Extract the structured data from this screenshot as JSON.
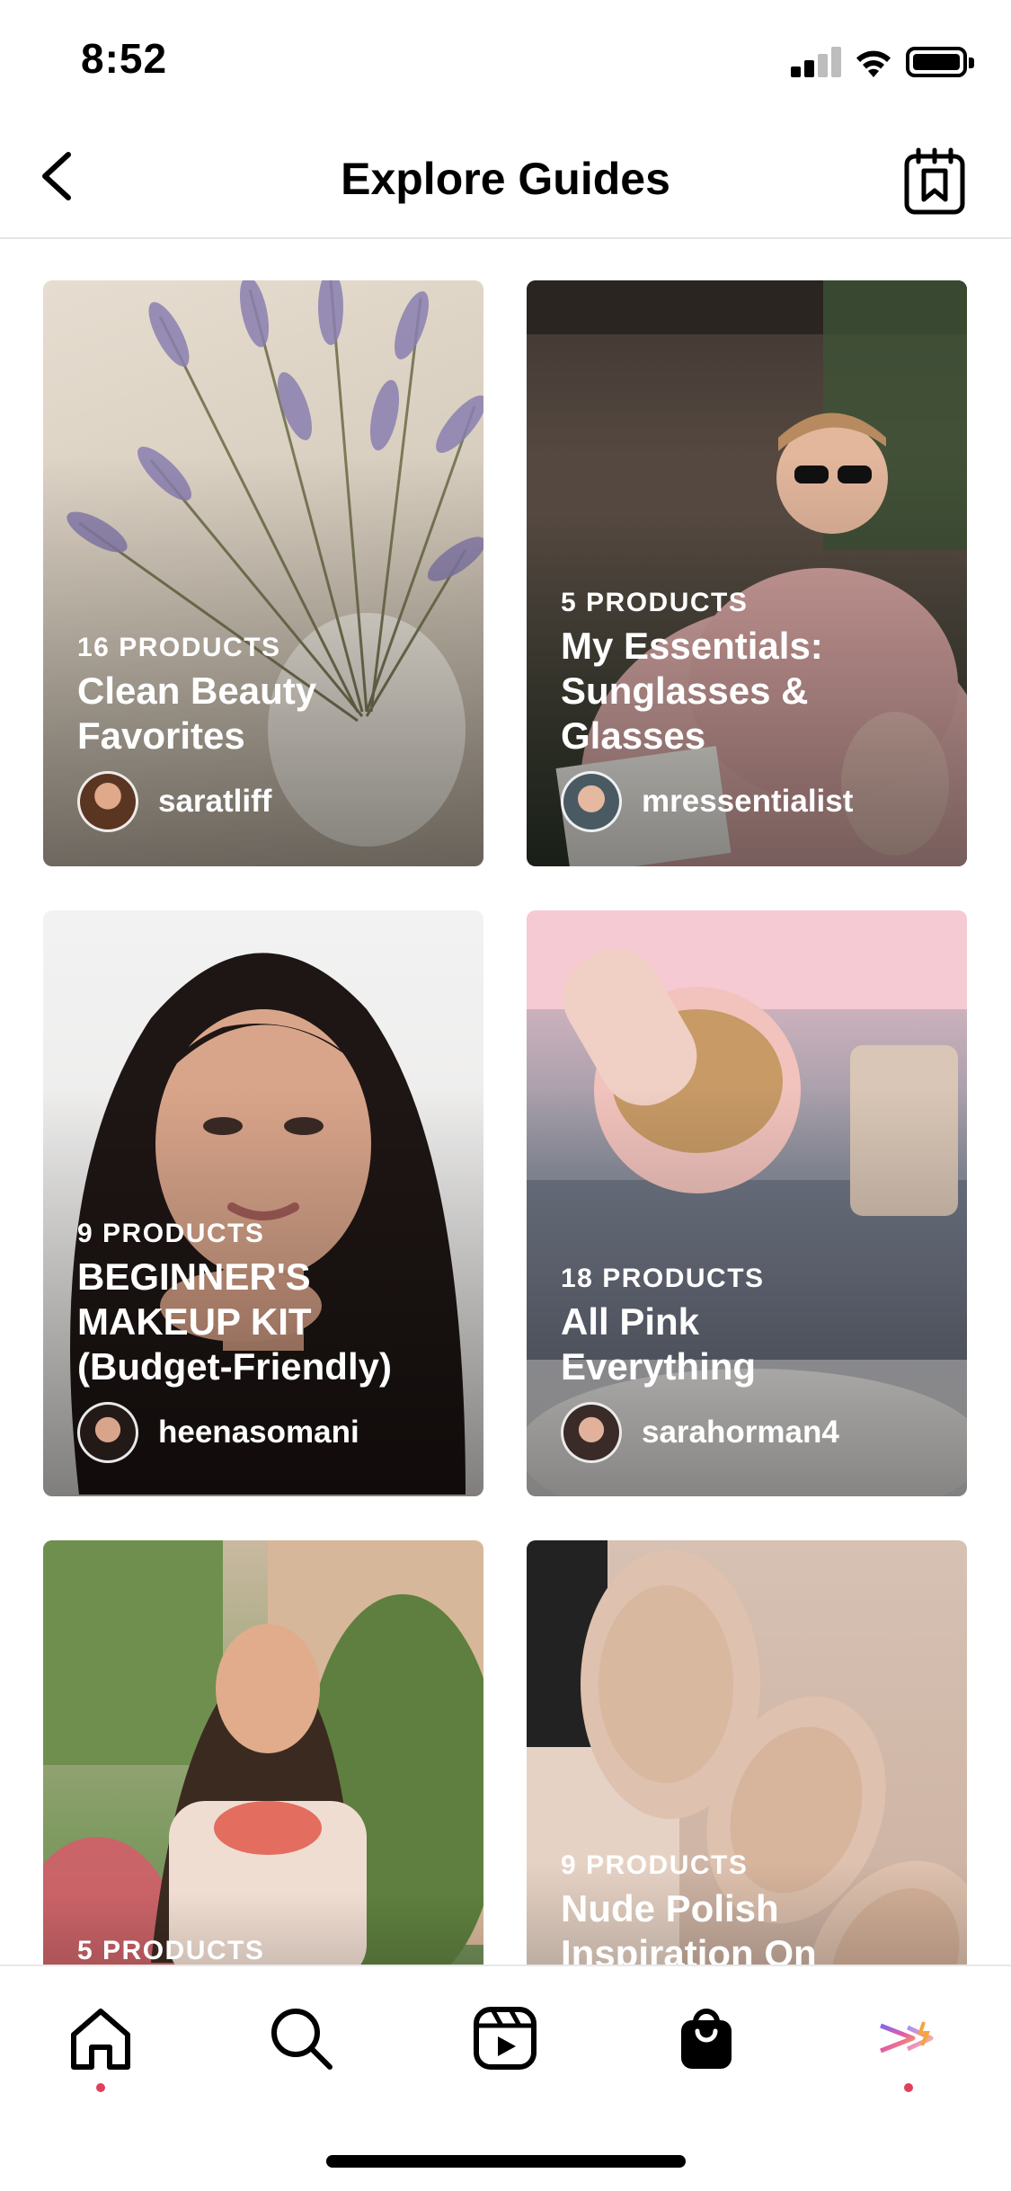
{
  "status_bar": {
    "time": "8:52"
  },
  "header": {
    "title": "Explore Guides",
    "back_icon": "chevron-left-icon",
    "bookmark_icon": "saved-guides-icon"
  },
  "guides": [
    {
      "count": "16 PRODUCTS",
      "title_lines": [
        "Clean Beauty",
        "Favorites"
      ],
      "author": "saratliff"
    },
    {
      "count": "5 PRODUCTS",
      "title_lines": [
        "My Essentials:",
        "Sunglasses &",
        "Glasses"
      ],
      "author": "mressentialist"
    },
    {
      "count": "9 PRODUCTS",
      "title_lines": [
        "BEGINNER'S",
        "MAKEUP KIT",
        "(Budget-Friendly)"
      ],
      "author": "heenasomani"
    },
    {
      "count": "18 PRODUCTS",
      "title_lines": [
        "All Pink",
        "Everything"
      ],
      "author": "sarahorman4"
    },
    {
      "count": "5 PRODUCTS",
      "title_lines": [],
      "author": ""
    },
    {
      "count": "9 PRODUCTS",
      "title_lines": [
        "Nude Polish",
        "Inspiration On"
      ],
      "author": ""
    }
  ],
  "tab_bar": {
    "items": [
      "home-icon",
      "search-icon",
      "reels-icon",
      "shop-icon",
      "activity-icon"
    ],
    "accent_dot_color": "#e0415a"
  }
}
